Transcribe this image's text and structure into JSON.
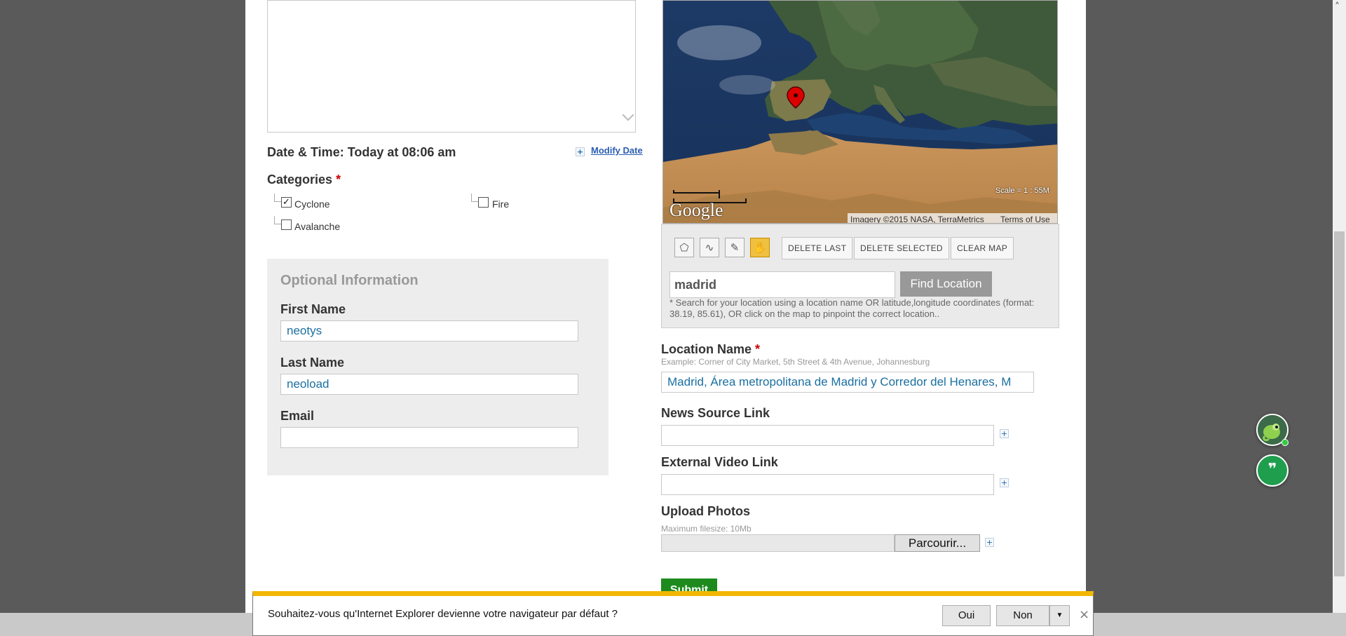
{
  "form": {
    "datetime_label": "Date & Time: Today at 08:06 am",
    "modify_date": "Modify Date",
    "categories_title": "Categories",
    "required_mark": "*",
    "categories": [
      {
        "label": "Cyclone",
        "checked": true
      },
      {
        "label": "Fire",
        "checked": false
      },
      {
        "label": "Avalanche",
        "checked": false
      }
    ],
    "optional": {
      "title": "Optional Information",
      "first_name_label": "First Name",
      "first_name_value": "neotys",
      "last_name_label": "Last Name",
      "last_name_value": "neoload",
      "email_label": "Email",
      "email_value": ""
    }
  },
  "map": {
    "attribution": "Imagery ©2015 NASA, TerraMetrics",
    "terms": "Terms of Use",
    "scale": "Scale = 1 : 55M",
    "google_logo": "Google",
    "buttons": {
      "delete_last": "DELETE LAST",
      "delete_selected": "DELETE SELECTED",
      "clear_map": "CLEAR MAP"
    },
    "tools": [
      "polygon-icon",
      "line-icon",
      "edit-icon",
      "hand-icon"
    ],
    "search_value": "madrid",
    "find_button": "Find Location",
    "hint": "* Search for your location using a location name OR latitude,longitude coordinates (format: 38.19, 85.61), OR click on the map to pinpoint the correct location.."
  },
  "location": {
    "label": "Location Name",
    "example": "Example: Corner of City Market, 5th Street & 4th Avenue, Johannesburg",
    "value": "Madrid, Área metropolitana de Madrid y Corredor del Henares, M"
  },
  "news_link": {
    "label": "News Source Link",
    "value": ""
  },
  "video_link": {
    "label": "External Video Link",
    "value": ""
  },
  "upload": {
    "label": "Upload Photos",
    "hint": "Maximum filesize: 10Mb",
    "browse": "Parcourir..."
  },
  "submit": "Submit",
  "ie_bar": {
    "message": "Souhaitez-vous qu'Internet Explorer devienne votre navigateur par défaut ?",
    "yes": "Oui",
    "no": "Non",
    "close": "×"
  },
  "colors": {
    "accent_submit": "#1e8a1e",
    "ie_bar_stripe": "#f2b705",
    "link": "#2a5db0"
  }
}
